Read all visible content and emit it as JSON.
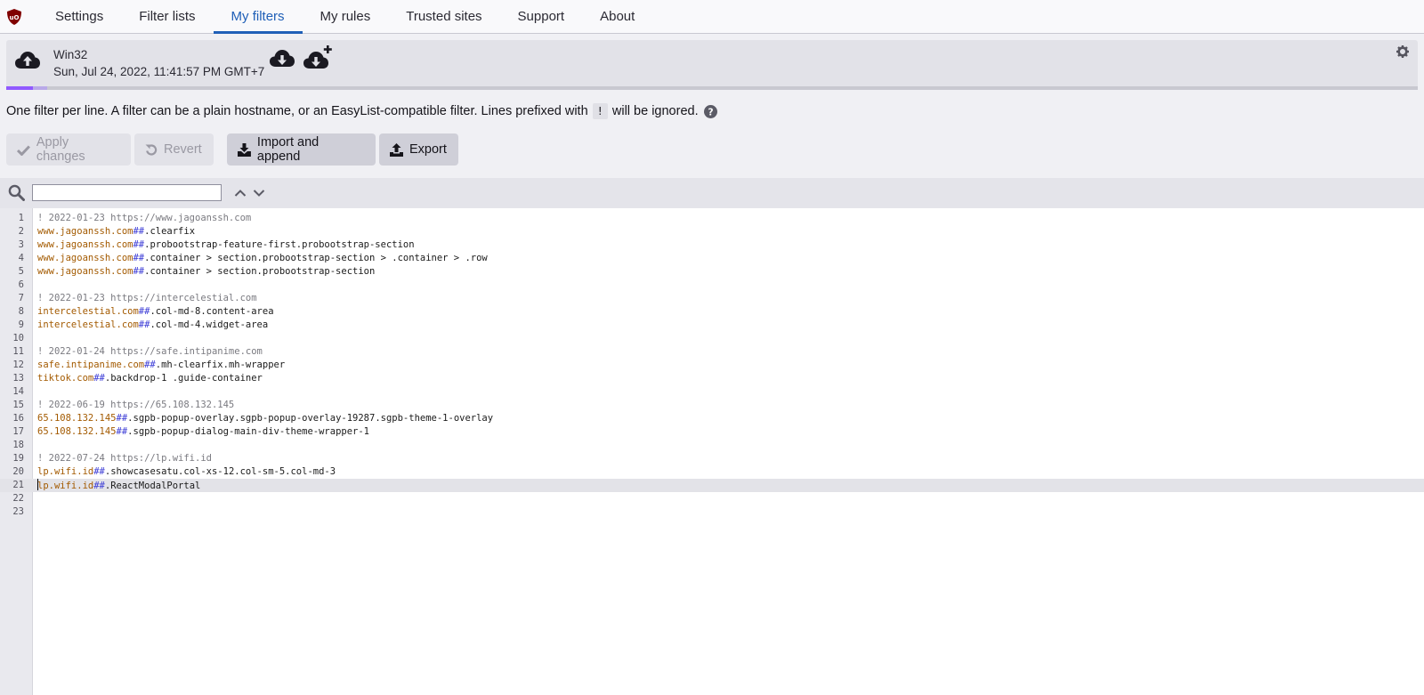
{
  "nav": {
    "tabs": [
      {
        "label": "Settings"
      },
      {
        "label": "Filter lists"
      },
      {
        "label": "My filters",
        "active": true
      },
      {
        "label": "My rules"
      },
      {
        "label": "Trusted sites"
      },
      {
        "label": "Support"
      },
      {
        "label": "About"
      }
    ]
  },
  "cloud": {
    "device": "Win32",
    "timestamp": "Sun, Jul 24, 2022, 11:41:57 PM GMT+7",
    "usage_fraction": 0.019
  },
  "notice": {
    "text_before": "One filter per line. A filter can be a plain hostname, or an EasyList-compatible filter. Lines prefixed with",
    "code": "!",
    "text_after": "will be ignored."
  },
  "buttons": {
    "apply": "Apply changes",
    "revert": "Revert",
    "import": "Import and append",
    "export": "Export"
  },
  "search": {
    "value": ""
  },
  "editor": {
    "current_line": 21,
    "lines": [
      {
        "n": "1",
        "comment": "! 2022-01-23 https://www.jagoanssh.com"
      },
      {
        "n": "2",
        "host": "www.jagoanssh.com",
        "sep": "##",
        "sel": ".clearfix"
      },
      {
        "n": "3",
        "host": "www.jagoanssh.com",
        "sep": "##",
        "sel": ".probootstrap-feature-first.probootstrap-section"
      },
      {
        "n": "4",
        "host": "www.jagoanssh.com",
        "sep": "##",
        "sel": ".container > section.probootstrap-section > .container > .row"
      },
      {
        "n": "5",
        "host": "www.jagoanssh.com",
        "sep": "##",
        "sel": ".container > section.probootstrap-section"
      },
      {
        "n": "6"
      },
      {
        "n": "7",
        "comment": "! 2022-01-23 https://intercelestial.com"
      },
      {
        "n": "8",
        "host": "intercelestial.com",
        "sep": "##",
        "sel": ".col-md-8.content-area"
      },
      {
        "n": "9",
        "host": "intercelestial.com",
        "sep": "##",
        "sel": ".col-md-4.widget-area"
      },
      {
        "n": "10"
      },
      {
        "n": "11",
        "comment": "! 2022-01-24 https://safe.intipanime.com"
      },
      {
        "n": "12",
        "host": "safe.intipanime.com",
        "sep": "##",
        "sel": ".mh-clearfix.mh-wrapper"
      },
      {
        "n": "13",
        "host": "tiktok.com",
        "sep": "##",
        "sel": ".backdrop-1 .guide-container"
      },
      {
        "n": "14"
      },
      {
        "n": "15",
        "comment": "! 2022-06-19 https://65.108.132.145"
      },
      {
        "n": "16",
        "host": "65.108.132.145",
        "sep": "##",
        "sel": ".sgpb-popup-overlay.sgpb-popup-overlay-19287.sgpb-theme-1-overlay"
      },
      {
        "n": "17",
        "host": "65.108.132.145",
        "sep": "##",
        "sel": ".sgpb-popup-dialog-main-div-theme-wrapper-1"
      },
      {
        "n": "18"
      },
      {
        "n": "19",
        "comment": "! 2022-07-24 https://lp.wifi.id"
      },
      {
        "n": "20",
        "host": "lp.wifi.id",
        "sep": "##",
        "sel": ".showcasesatu.col-xs-12.col-sm-5.col-md-3"
      },
      {
        "n": "21",
        "host": "lp.wifi.id",
        "sep": "##",
        "sel": ".ReactModalPortal"
      },
      {
        "n": "22"
      },
      {
        "n": "23"
      }
    ]
  }
}
